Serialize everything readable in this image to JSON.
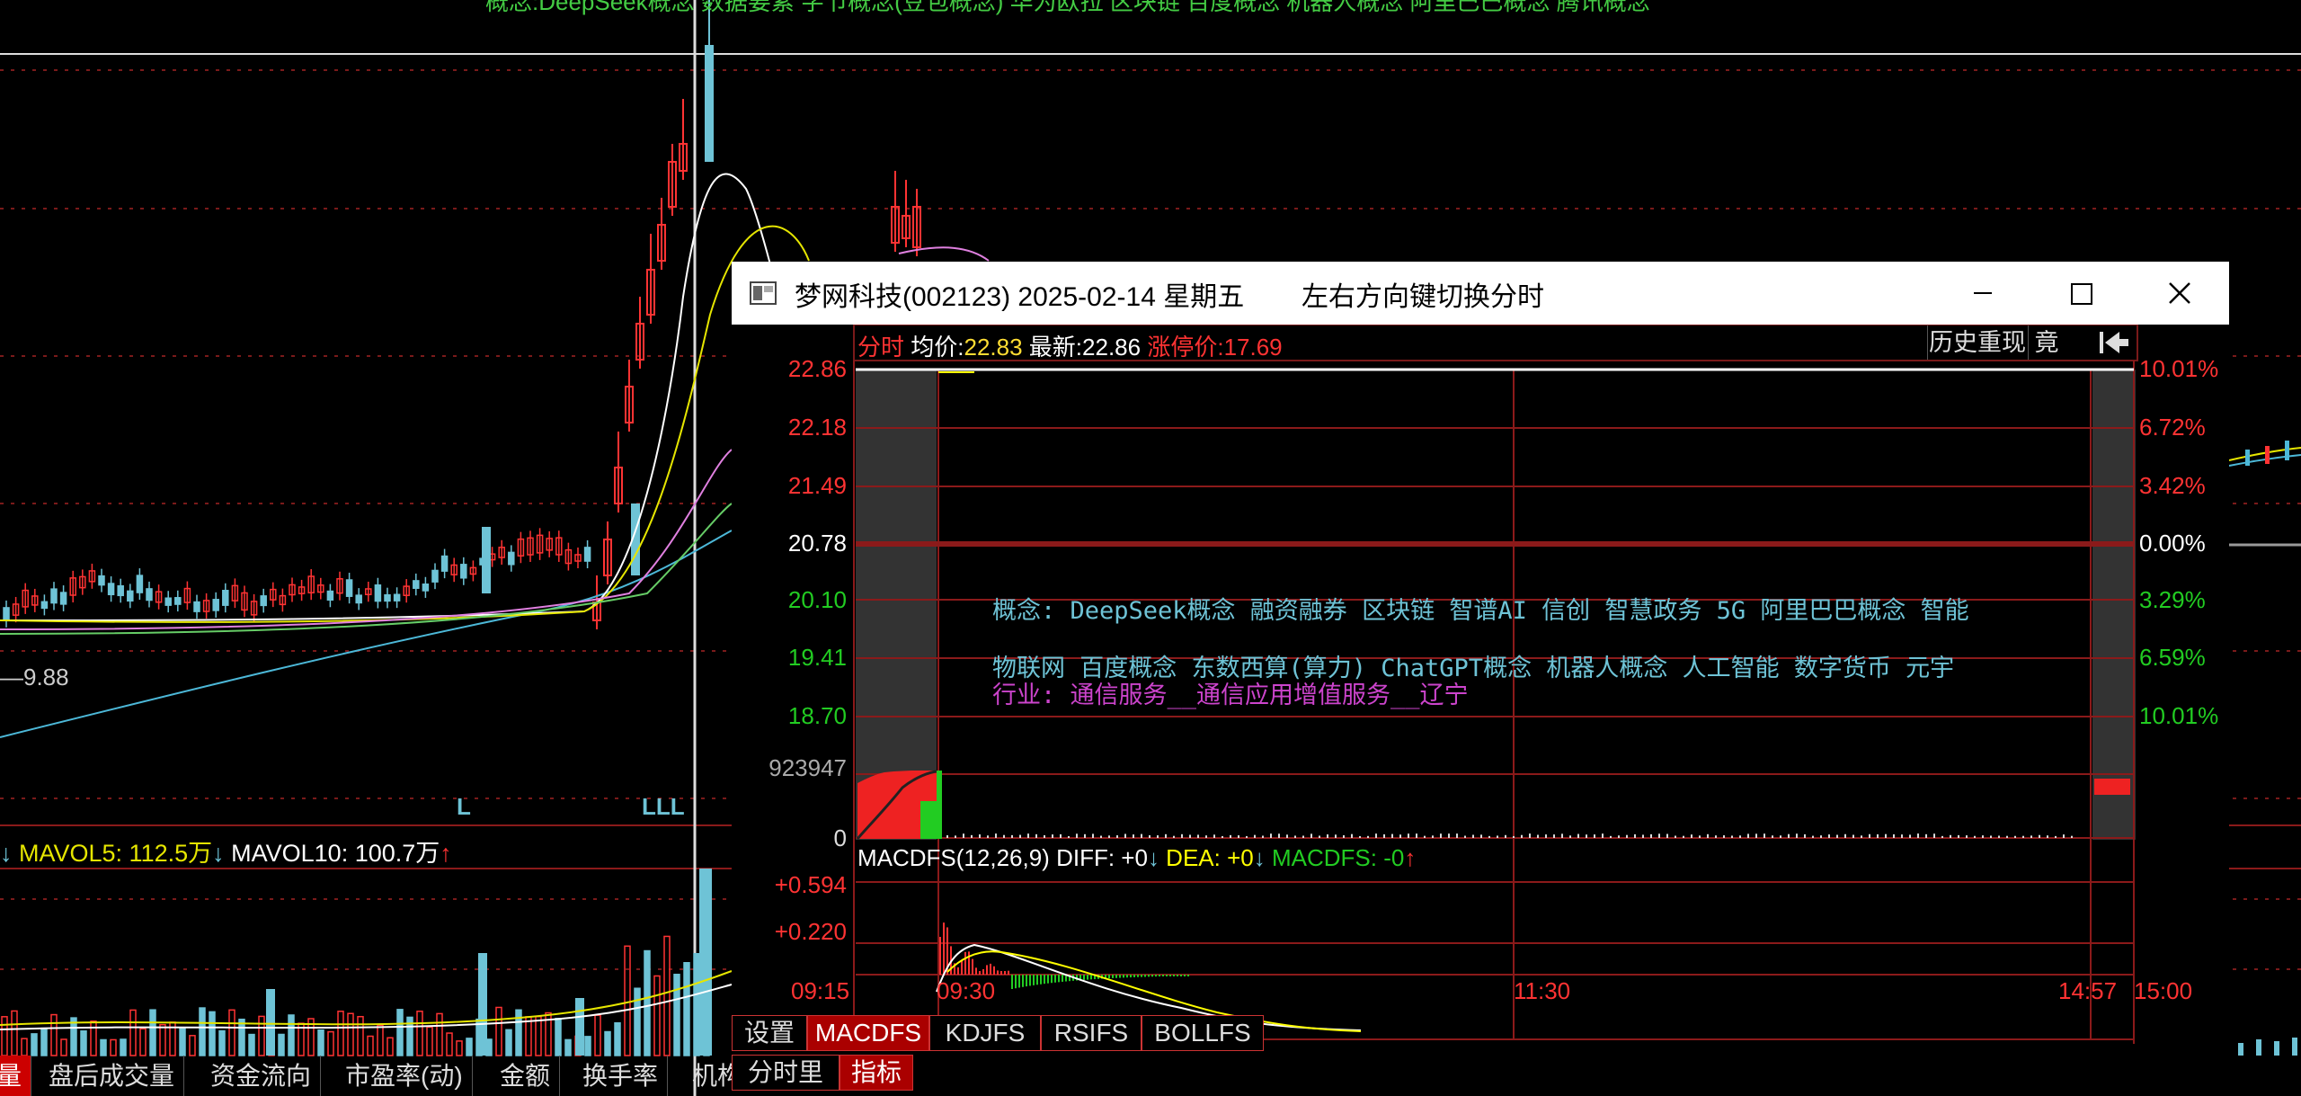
{
  "main": {
    "top_ticker": "概念:DeepSeek概念 数据要素 字节概念(豆包概念) 华为欧拉 区块链 百度概念 机器人概念 阿里巴巴概念 腾讯概念",
    "price_label": "9.88",
    "markers": [
      "L",
      "LLL"
    ],
    "volume_legend": {
      "arrow1": "↓",
      "mavol5_label": "MAVOL5: 112.5万",
      "arrow2": "↓",
      "mavol10_label": "MAVOL10: 100.7万",
      "arrow3": "↑"
    },
    "bottom_tabs": [
      "量",
      "盘后成交量",
      "资金流向",
      "市盈率(动)",
      "金额",
      "换手率",
      "机构持股"
    ],
    "active_tab": 0
  },
  "window": {
    "title": "梦网科技(002123) 2025-02-14 星期五",
    "hint": "左右方向键切换分时",
    "header": {
      "mode": "分时",
      "avg_label": "均价:",
      "avg_value": "22.83",
      "last_label": "最新:",
      "last_value": "22.86",
      "limit_label": "涨停价:",
      "limit_value": "17.69"
    },
    "buttons": {
      "history_replay": "历史重现",
      "auction": "竟",
      "back_icon": "back-arrow-icon"
    },
    "price_axis": [
      "22.86",
      "22.18",
      "21.49",
      "20.78",
      "20.10",
      "19.41",
      "18.70"
    ],
    "pct_axis": [
      "10.01%",
      "6.72%",
      "3.42%",
      "0.00%",
      "3.29%",
      "6.59%",
      "10.01%"
    ],
    "volume_axis": [
      "923947",
      "0"
    ],
    "concepts_line1": "概念: DeepSeek概念 融资融券 区块链 智谱AI 信创 智慧政务 5G 阿里巴巴概念 智能",
    "concepts_line2": "物联网 百度概念 东数西算(算力) ChatGPT概念 机器人概念 人工智能 数字货币 元宇",
    "industry": "行业: 通信服务__通信应用增值服务__辽宁",
    "macd_legend": {
      "name": "MACDFS(12,26,9)",
      "diff": "DIFF: +0",
      "diff_arrow": "↓",
      "dea": "DEA: +0",
      "dea_arrow": "↓",
      "macdfs": "MACDFS: -0",
      "macdfs_arrow": "↑"
    },
    "macd_axis": [
      "+0.594",
      "+0.220"
    ],
    "time_axis": [
      "09:15",
      "09:30",
      "11:30",
      "14:57",
      "15:00"
    ],
    "indicator_tabs": [
      "设置",
      "MACDFS",
      "KDJFS",
      "RSIFS",
      "BOLLFS"
    ],
    "active_indicator": 1,
    "bottom_tabs": [
      "分时里",
      "指标"
    ],
    "active_bottom_tab": 1
  },
  "colors": {
    "up": "#ff3333",
    "down": "#22cc22",
    "cyan": "#6ec3d6",
    "yellow": "#ffff00",
    "grid": "#8b1a1a"
  }
}
